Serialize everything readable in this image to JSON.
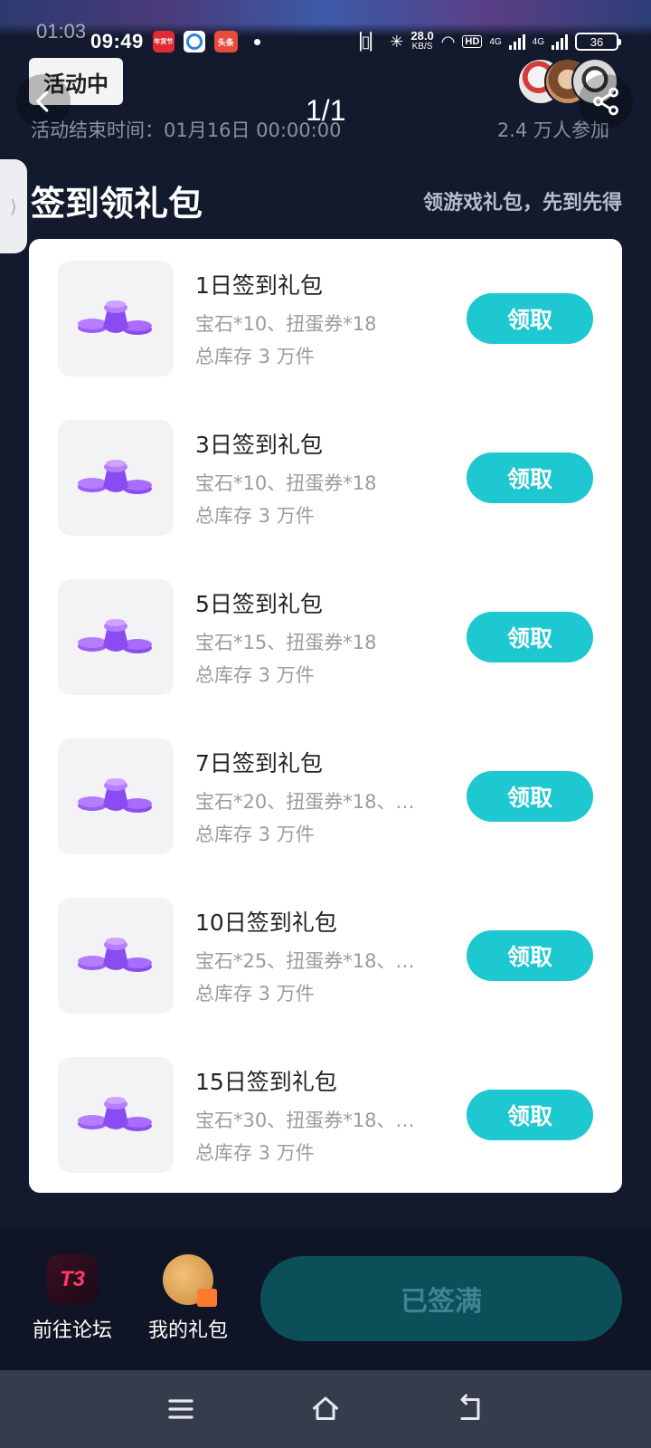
{
  "status_bar": {
    "time": "09:49",
    "time_ghost": "01:03",
    "app_badges": [
      "年货节",
      "",
      "头条"
    ],
    "net_speed_value": "28.0",
    "net_speed_unit": "KB/S",
    "network_tag": "HD",
    "network_type": "4G",
    "battery": "36"
  },
  "header": {
    "status_chip": "活动中",
    "page_counter": "1/1",
    "end_time": "活动结束时间：01月16日 00:00:00",
    "participants": "2.4 万人参加"
  },
  "section": {
    "title": "签到领礼包",
    "subtitle": "领游戏礼包，先到先得"
  },
  "gifts": [
    {
      "name": "1日签到礼包",
      "content": "宝石*10、扭蛋券*18",
      "stock": "总库存 3 万件",
      "button": "领取"
    },
    {
      "name": "3日签到礼包",
      "content": "宝石*10、扭蛋券*18",
      "stock": "总库存 3 万件",
      "button": "领取"
    },
    {
      "name": "5日签到礼包",
      "content": "宝石*15、扭蛋券*18",
      "stock": "总库存 3 万件",
      "button": "领取"
    },
    {
      "name": "7日签到礼包",
      "content": "宝石*20、扭蛋券*18、…",
      "stock": "总库存 3 万件",
      "button": "领取"
    },
    {
      "name": "10日签到礼包",
      "content": "宝石*25、扭蛋券*18、…",
      "stock": "总库存 3 万件",
      "button": "领取"
    },
    {
      "name": "15日签到礼包",
      "content": "宝石*30、扭蛋券*18、…",
      "stock": "总库存 3 万件",
      "button": "领取"
    }
  ],
  "bottom_bar": {
    "forum_logo": "T3",
    "forum_label": "前往论坛",
    "my_gifts_label": "我的礼包",
    "signed_full_label": "已签满"
  },
  "colors": {
    "background": "#131a2e",
    "accent": "#1dc8d0",
    "disabled_button": "#0b4f59",
    "gem_purple": "#8a4cf0"
  },
  "icons": {
    "back": "chevron-left-icon",
    "share": "share-icon",
    "side_handle": "chevron-right-icon",
    "gift": "purple-gems-icon",
    "nav_menu": "menu-icon",
    "nav_home": "home-icon",
    "nav_back": "return-icon"
  }
}
